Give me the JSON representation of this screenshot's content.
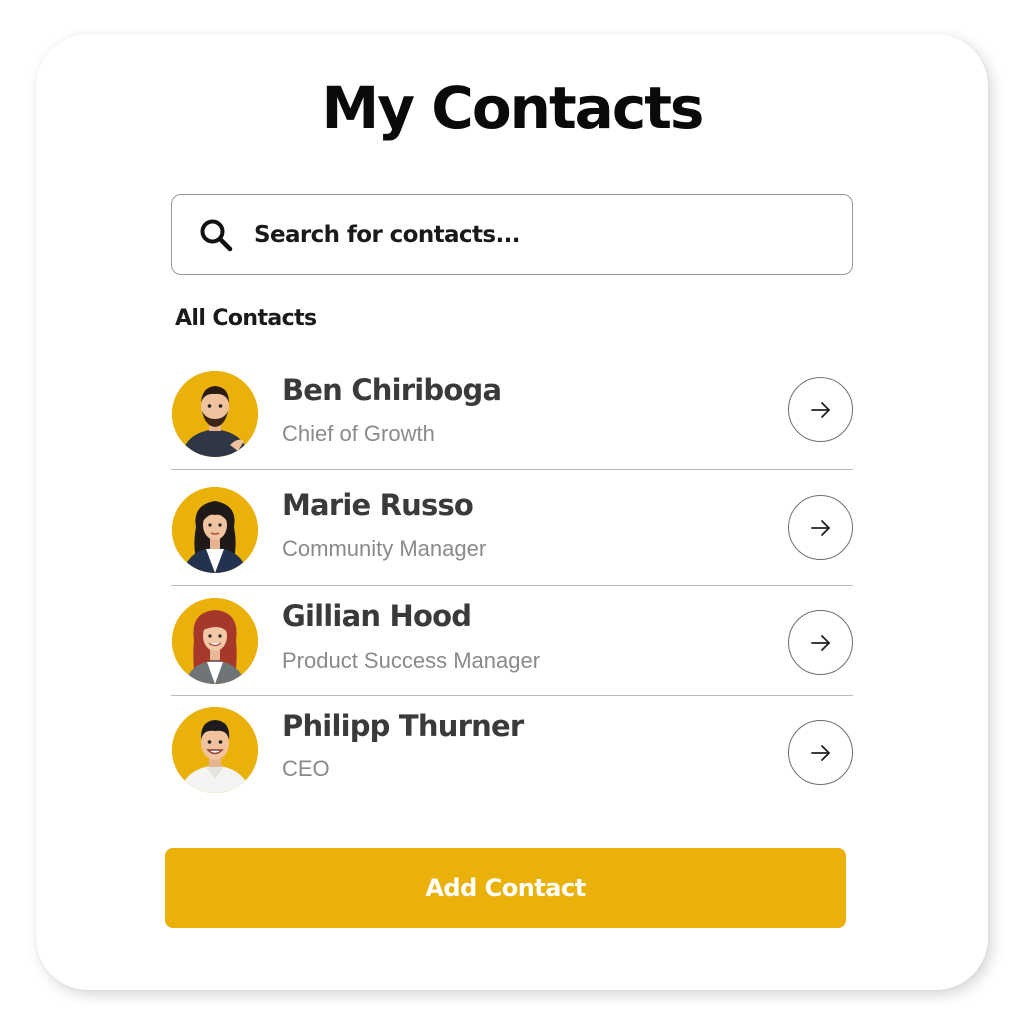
{
  "header": {
    "title": "My Contacts"
  },
  "search": {
    "placeholder": "Search for contacts...",
    "icon": "search-icon"
  },
  "contacts_section": {
    "label": "All Contacts",
    "items": [
      {
        "name": "Ben Chiriboga",
        "role": "Chief of Growth",
        "avatar": "avatar-man-beard",
        "action_icon": "arrow-right-icon"
      },
      {
        "name": "Marie Russo",
        "role": "Community Manager",
        "avatar": "avatar-woman-dark-hair",
        "action_icon": "arrow-right-icon"
      },
      {
        "name": "Gillian Hood",
        "role": "Product Success Manager",
        "avatar": "avatar-woman-red-hair",
        "action_icon": "arrow-right-icon"
      },
      {
        "name": "Philipp Thurner",
        "role": "CEO",
        "avatar": "avatar-man-smiling",
        "action_icon": "arrow-right-icon"
      }
    ]
  },
  "actions": {
    "add_label": "Add Contact"
  },
  "colors": {
    "accent": "#e9b10a",
    "title": "#0a0a0a",
    "name": "#3a3a3a",
    "role": "#8a8a8a",
    "divider": "#b9b9b9"
  }
}
